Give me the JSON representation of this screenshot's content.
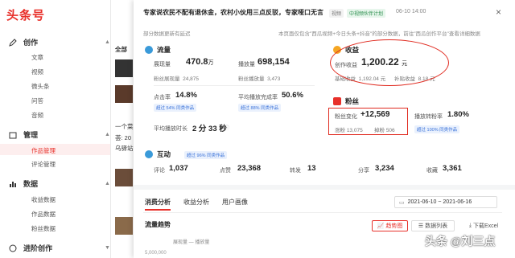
{
  "brand": "头条号",
  "sidebar": {
    "sections": [
      {
        "label": "创作",
        "items": [
          "文章",
          "视频",
          "微头条",
          "问答",
          "音频"
        ]
      },
      {
        "label": "管理",
        "items": [
          "作品管理",
          "评论管理"
        ]
      },
      {
        "label": "数据",
        "items": [
          "收益数据",
          "作品数据",
          "粉丝数据"
        ]
      },
      {
        "label": "进阶创作"
      }
    ],
    "active_item": "作品管理"
  },
  "background": {
    "heading": "全部",
    "snippet1": "一个菜",
    "snippet2": "荟: 20",
    "snippet3": "乌驿站"
  },
  "panel": {
    "title": "专家说农民不配有退休金，农村小伙用三点反驳，专家哑口无言",
    "tag_video": "视频",
    "tag_plan": "中视频伙伴计划",
    "date": "06-10 14:00",
    "close": "×",
    "note_left": "部分数据更新有延迟",
    "note_right": "本页面仅包含\"西瓜视频+今日头条+抖音\"的部分数据，前往\"西瓜创作平台\"查看详细数据",
    "traffic": {
      "title": "流量",
      "impressions_label": "展现量",
      "impressions_value": "470.8",
      "impressions_unit": "万",
      "plays_label": "播放量",
      "plays_value": "698,154",
      "fan_impr_label": "粉丝展现量",
      "fan_impr_value": "24,875",
      "fan_plays_label": "粉丝播放量",
      "fan_plays_value": "3,473",
      "ctr_label": "点击率",
      "ctr_value": "14.8%",
      "completion_label": "平均播放完成率",
      "completion_value": "50.6%",
      "ctr_pill": "超过 54% 同类作品",
      "completion_pill": "超过 88% 同类作品",
      "avg_time_label": "平均播放时长",
      "avg_time_value": "2 分 33 秒"
    },
    "income": {
      "title": "收益",
      "creation_label": "创作收益",
      "creation_value": "1,200.22",
      "currency": "元",
      "basic_label": "基础收益",
      "basic_value": "1,192.04 元",
      "subsidy_label": "补贴收益",
      "subsidy_value": "8.18 元"
    },
    "fans": {
      "title": "粉丝",
      "change_label": "粉丝变化",
      "change_value": "+12,569",
      "gain_label": "涨粉",
      "gain_value": "13,075",
      "loss_label": "掉粉",
      "loss_value": "506",
      "conv_label": "播放转粉率",
      "conv_value": "1.80%",
      "conv_pill": "超过 100% 同类作品"
    },
    "interaction": {
      "title": "互动",
      "pill": "超过 96% 同类作品",
      "comments_label": "评论",
      "comments_value": "1,037",
      "likes_label": "点赞",
      "likes_value": "23,368",
      "reposts_label": "转发",
      "reposts_value": "13",
      "shares_label": "分享",
      "shares_value": "3,234",
      "favorites_label": "收藏",
      "favorites_value": "3,361"
    },
    "tabs": [
      "消费分析",
      "收益分析",
      "用户画像"
    ],
    "date_range": "2021-06-10  ~  2021-06-16",
    "trend_title": "流量趋势",
    "btn_trend": "趋势图",
    "btn_table": "数据列表",
    "btn_download": "下载Excel",
    "legend_label": "展现量 — 播放量",
    "y_top": "5,000,000"
  },
  "watermark": "头条 @刘三点",
  "colors": {
    "brand_red": "#e8302a",
    "highlight_red": "#e02a1f",
    "pill_blue": "#3a72d9"
  }
}
